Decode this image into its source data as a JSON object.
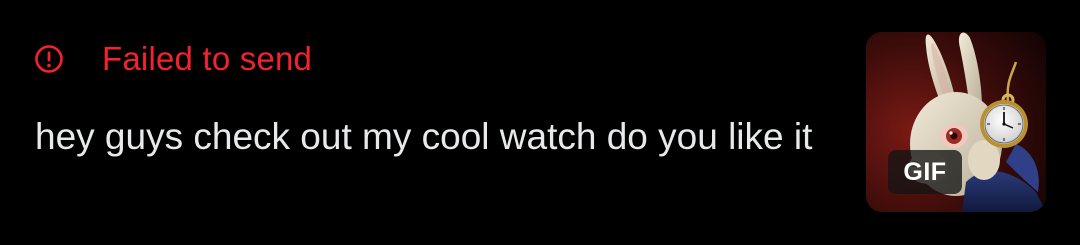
{
  "draft": {
    "status": {
      "icon": "alert-circle-icon",
      "text": "Failed to send",
      "color": "#F4212E"
    },
    "message": "hey guys check out my cool watch do you like it",
    "attachment": {
      "type": "gif",
      "badge": "GIF",
      "subject": "white-rabbit-with-pocket-watch"
    }
  }
}
